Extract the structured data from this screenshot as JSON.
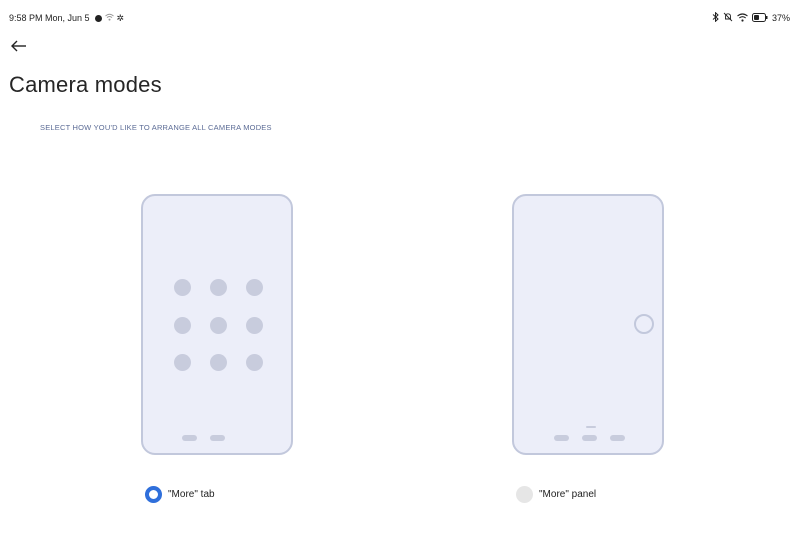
{
  "status_bar": {
    "time_date": "9:58 PM Mon, Jun 5",
    "battery": "37%"
  },
  "page": {
    "title": "Camera modes",
    "subtitle": "SELECT HOW YOU'D LIKE TO ARRANGE ALL CAMERA MODES"
  },
  "options": [
    {
      "label": "\"More\" tab",
      "selected": true
    },
    {
      "label": "\"More\" panel",
      "selected": false
    }
  ],
  "colors": {
    "accent": "#2f6fdb",
    "preview_bg": "#eceef9",
    "preview_border": "#c2c8dc"
  }
}
